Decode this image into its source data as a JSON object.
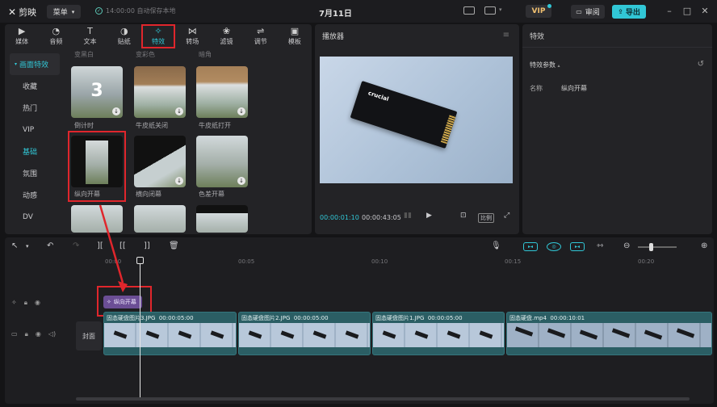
{
  "titlebar": {
    "app_name": "剪映",
    "menu_label": "菜单",
    "save_status": "14:00:00 自动保存本地",
    "project_title": "7月11日",
    "vip_label": "VIP",
    "review_label": "审阅",
    "export_label": "导出"
  },
  "tabs": [
    {
      "icon": "media-icon",
      "label": "媒体"
    },
    {
      "icon": "audio-icon",
      "label": "音频"
    },
    {
      "icon": "text-icon",
      "label": "文本"
    },
    {
      "icon": "sticker-icon",
      "label": "贴纸"
    },
    {
      "icon": "effects-icon",
      "label": "特效"
    },
    {
      "icon": "transition-icon",
      "label": "转场"
    },
    {
      "icon": "filter-icon",
      "label": "滤镜"
    },
    {
      "icon": "adjust-icon",
      "label": "调节"
    },
    {
      "icon": "template-icon",
      "label": "模板"
    }
  ],
  "sidebar": {
    "items": [
      {
        "label": "画面特效",
        "state": "head"
      },
      {
        "label": "收藏",
        "state": ""
      },
      {
        "label": "热门",
        "state": ""
      },
      {
        "label": "VIP",
        "state": ""
      },
      {
        "label": "基础",
        "state": "active"
      },
      {
        "label": "氛围",
        "state": ""
      },
      {
        "label": "动感",
        "state": ""
      },
      {
        "label": "DV",
        "state": ""
      }
    ]
  },
  "effects_grid": {
    "top_labels": [
      "变黑白",
      "变彩色",
      "暗角"
    ],
    "row1": [
      "倒计时",
      "牛皮纸关闭",
      "牛皮纸打开"
    ],
    "row2": [
      "纵向开幕",
      "横向闭幕",
      "色差开幕"
    ],
    "countdown_digit": "3"
  },
  "player": {
    "title": "播放器",
    "current_time": "00:00:01:10",
    "total_time": "00:00:43:05",
    "ratio_label": "比例",
    "product_label": "crucial"
  },
  "properties": {
    "title": "特效",
    "section": "特效参数",
    "name_key": "名称",
    "name_value": "纵向开幕"
  },
  "timeline": {
    "ruler": [
      "00:00",
      "00:05",
      "00:10",
      "00:15",
      "00:20"
    ],
    "effect_clip_label": "纵向开幕",
    "cover_label": "封面",
    "clips": [
      {
        "name": "固态硬盘图片3.JPG",
        "duration": "00:00:05:00"
      },
      {
        "name": "固态硬盘图片2.JPG",
        "duration": "00:00:05:00"
      },
      {
        "name": "固态硬盘图片1.JPG",
        "duration": "00:00:05:00"
      },
      {
        "name": "固态硬盘.mp4",
        "duration": "00:00:10:01"
      }
    ]
  },
  "colors": {
    "accent": "#31c7d6",
    "highlight": "#e0262c",
    "effect_clip": "#6b4e95",
    "video_clip": "#2b5e64"
  }
}
